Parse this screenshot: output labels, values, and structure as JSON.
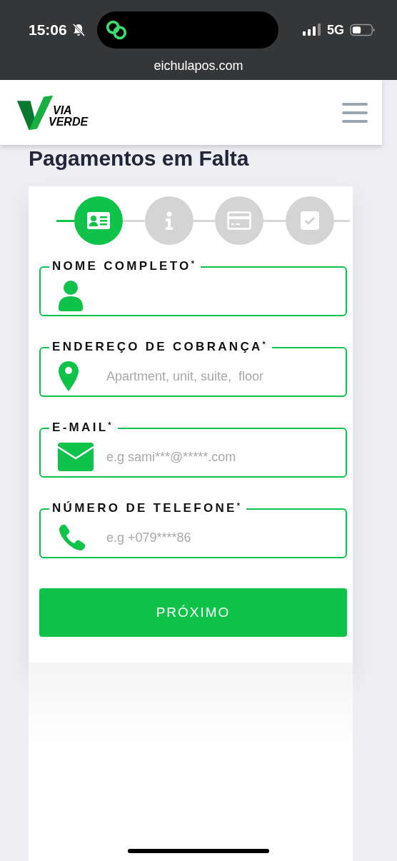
{
  "status_bar": {
    "time": "15:06",
    "network": "5G"
  },
  "browser": {
    "url": "eichulapos.com"
  },
  "header": {
    "logo_line_1": "VIA",
    "logo_line_2": "VERDE"
  },
  "title": "Pagamentos em Falta",
  "steps": [
    {
      "kind": "id",
      "selected": true
    },
    {
      "kind": "info",
      "selected": false
    },
    {
      "kind": "card",
      "selected": false
    },
    {
      "kind": "check",
      "selected": false
    }
  ],
  "fields": [
    {
      "kind": "person",
      "label": "NOME COMPLETO$^{*}$"
    },
    {
      "kind": "pin",
      "label": "ENDEREÇO DE COBRANÇA$^{*}$",
      "placeholder": "Apartment, unit, suite,  floor"
    },
    {
      "kind": "mail",
      "label": "E-MAIL$^{*}$",
      "placeholder": "e.g sami***@*****.com"
    },
    {
      "kind": "phone",
      "label": "NÚMERO DE TELEFONE$^{*}$",
      "placeholder": "e.g +079****86"
    }
  ],
  "next_button": "PRÓXIMO"
}
